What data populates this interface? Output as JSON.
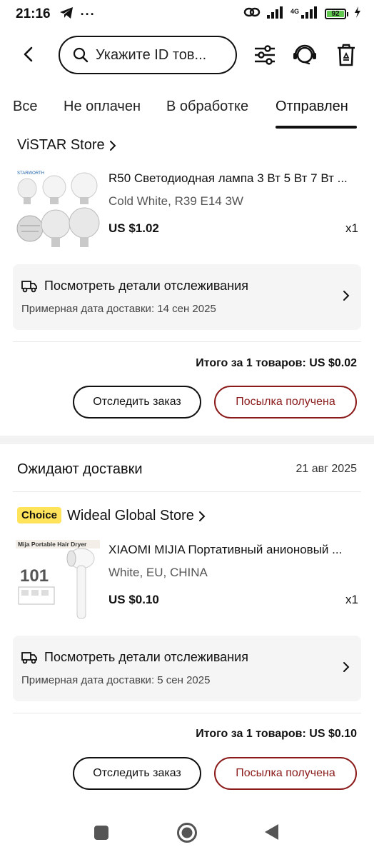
{
  "status_bar": {
    "time": "21:16",
    "more": "···",
    "network": "4G",
    "battery": "92"
  },
  "search": {
    "placeholder": "Укажите ID тов..."
  },
  "tabs": [
    {
      "label": "Все",
      "active": false
    },
    {
      "label": "Не оплачен",
      "active": false
    },
    {
      "label": "В обработке",
      "active": false
    },
    {
      "label": "Отправлен",
      "active": true
    }
  ],
  "orders": [
    {
      "store": "ViSTAR Store",
      "product_title": "R50 Светодиодная лампа 3 Вт 5 Вт 7 Вт ...",
      "variant": "Cold White, R39 E14 3W",
      "price": "US $1.02",
      "qty": "x1",
      "image_brand": "STARWORTH",
      "tracking_title": "Посмотреть детали отслеживания",
      "tracking_date": "Примерная дата доставки: 14 сен 2025",
      "total": "Итого за 1 товаров: US $0.02",
      "track_button": "Отследить заказ",
      "received_button": "Посылка получена"
    },
    {
      "store": "Wideal Global Store",
      "product_title": "XIAOMI MIJIA Портативный анионовый ...",
      "variant": "White, EU, CHINA",
      "price": "US $0.10",
      "qty": "x1",
      "image_caption": "Mija Portable Hair Dryer",
      "image_number": "101",
      "tracking_title": "Посмотреть детали отслеживания",
      "tracking_date": "Примерная дата доставки: 5 сен 2025",
      "total": "Итого за 1 товаров: US $0.10",
      "track_button": "Отследить заказ",
      "received_button": "Посылка получена"
    }
  ],
  "section": {
    "title": "Ожидают доставки",
    "date": "21 авг 2025",
    "badge": "Choice"
  },
  "colors": {
    "accent_red": "#8b1a1a",
    "choice_yellow": "#ffe35a",
    "battery_green": "#62c950"
  }
}
